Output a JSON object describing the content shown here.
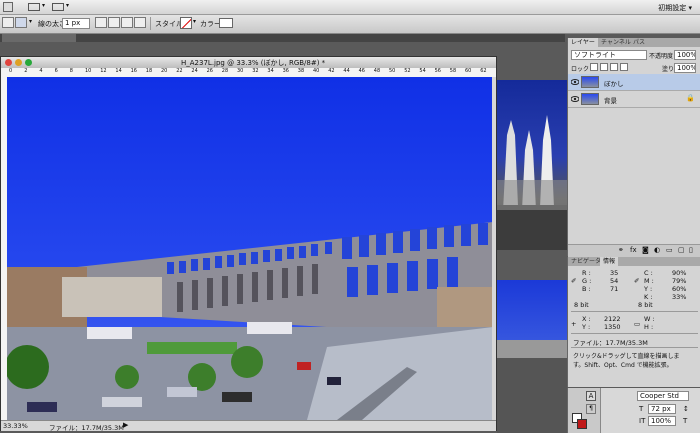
{
  "menubar": {
    "workspace_label": "初期設定 ▾"
  },
  "options_bar": {
    "line_width_label": "線の太さ：",
    "line_width_value": "1 px",
    "style_label": "スタイル：",
    "color_label": "カラー："
  },
  "document": {
    "title": "H_A237L.jpg @ 33.3% (ぼかし, RGB/8#) *",
    "ruler_ticks": [
      "0",
      "2",
      "4",
      "6",
      "8",
      "10",
      "12",
      "14",
      "16",
      "18",
      "20",
      "22",
      "24",
      "26",
      "28",
      "30",
      "32",
      "34",
      "36",
      "38",
      "40",
      "42",
      "44",
      "46",
      "48",
      "50",
      "52",
      "54",
      "56",
      "58",
      "60",
      "62"
    ],
    "zoom": "33.33%",
    "file_info": "ファイル：17.7M/35.3M"
  },
  "layers_panel": {
    "tabs": [
      "レイヤー",
      "チャンネル",
      "パス"
    ],
    "blend_mode": "ソフトライト",
    "opacity_label": "不透明度：",
    "opacity_value": "100%",
    "lock_label": "ロック：",
    "fill_label": "塗り：",
    "fill_value": "100%",
    "layers": [
      {
        "name": "ぼかし",
        "selected": true
      },
      {
        "name": "背景",
        "selected": false
      }
    ]
  },
  "info_panel": {
    "tabs": [
      "ナビゲータ",
      "情報"
    ],
    "r_label": "R :",
    "r_value": "35",
    "g_label": "G :",
    "g_value": "54",
    "b_label": "B :",
    "b_value": "71",
    "c_label": "C :",
    "c_value": "90%",
    "m_label": "M :",
    "m_value": "79%",
    "y_label": "Y :",
    "y_value": "60%",
    "k_label": "K :",
    "k_value": "33%",
    "bit_left": "8 bit",
    "bit_right": "8 bit",
    "x_label": "X :",
    "x_value": "2122",
    "yy_label": "Y :",
    "yy_value": "1350",
    "w_label": "W :",
    "h_label": "H :",
    "file_info": "ファイル：17.7M/35.3M",
    "hint_line1": "クリック&ドラッグして直線を描画しま",
    "hint_line2": "す。Shift、Opt、Cmd で機能拡張。"
  },
  "character_panel": {
    "font": "Cooper Std",
    "size": "72 px",
    "scale": "100%"
  },
  "colors": {
    "sky": "#1a3cf0",
    "layer_selected": "#b8cbe8",
    "panel_bg": "#d4d4d4"
  }
}
